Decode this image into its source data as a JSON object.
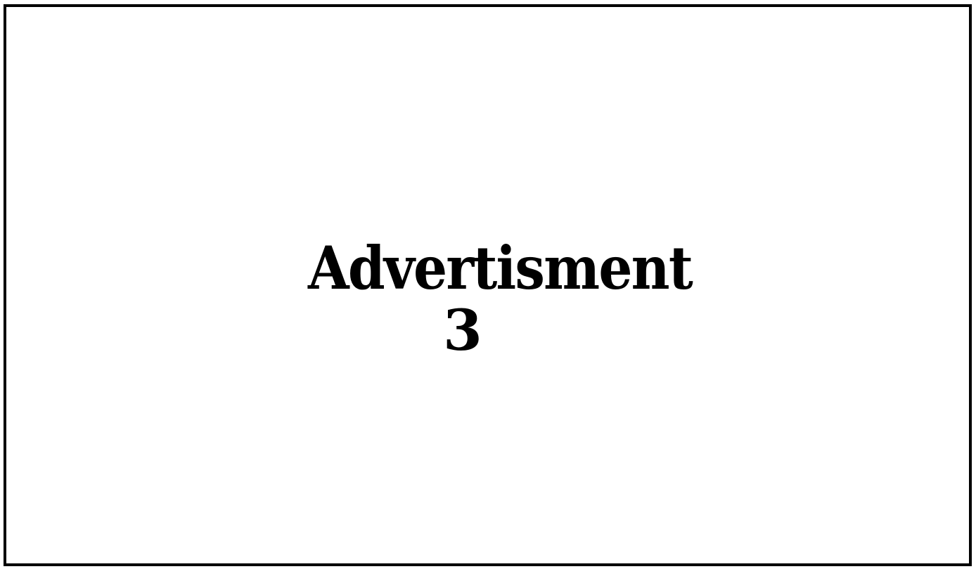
{
  "advertisement": {
    "title": "Advertisment",
    "number": "3"
  }
}
